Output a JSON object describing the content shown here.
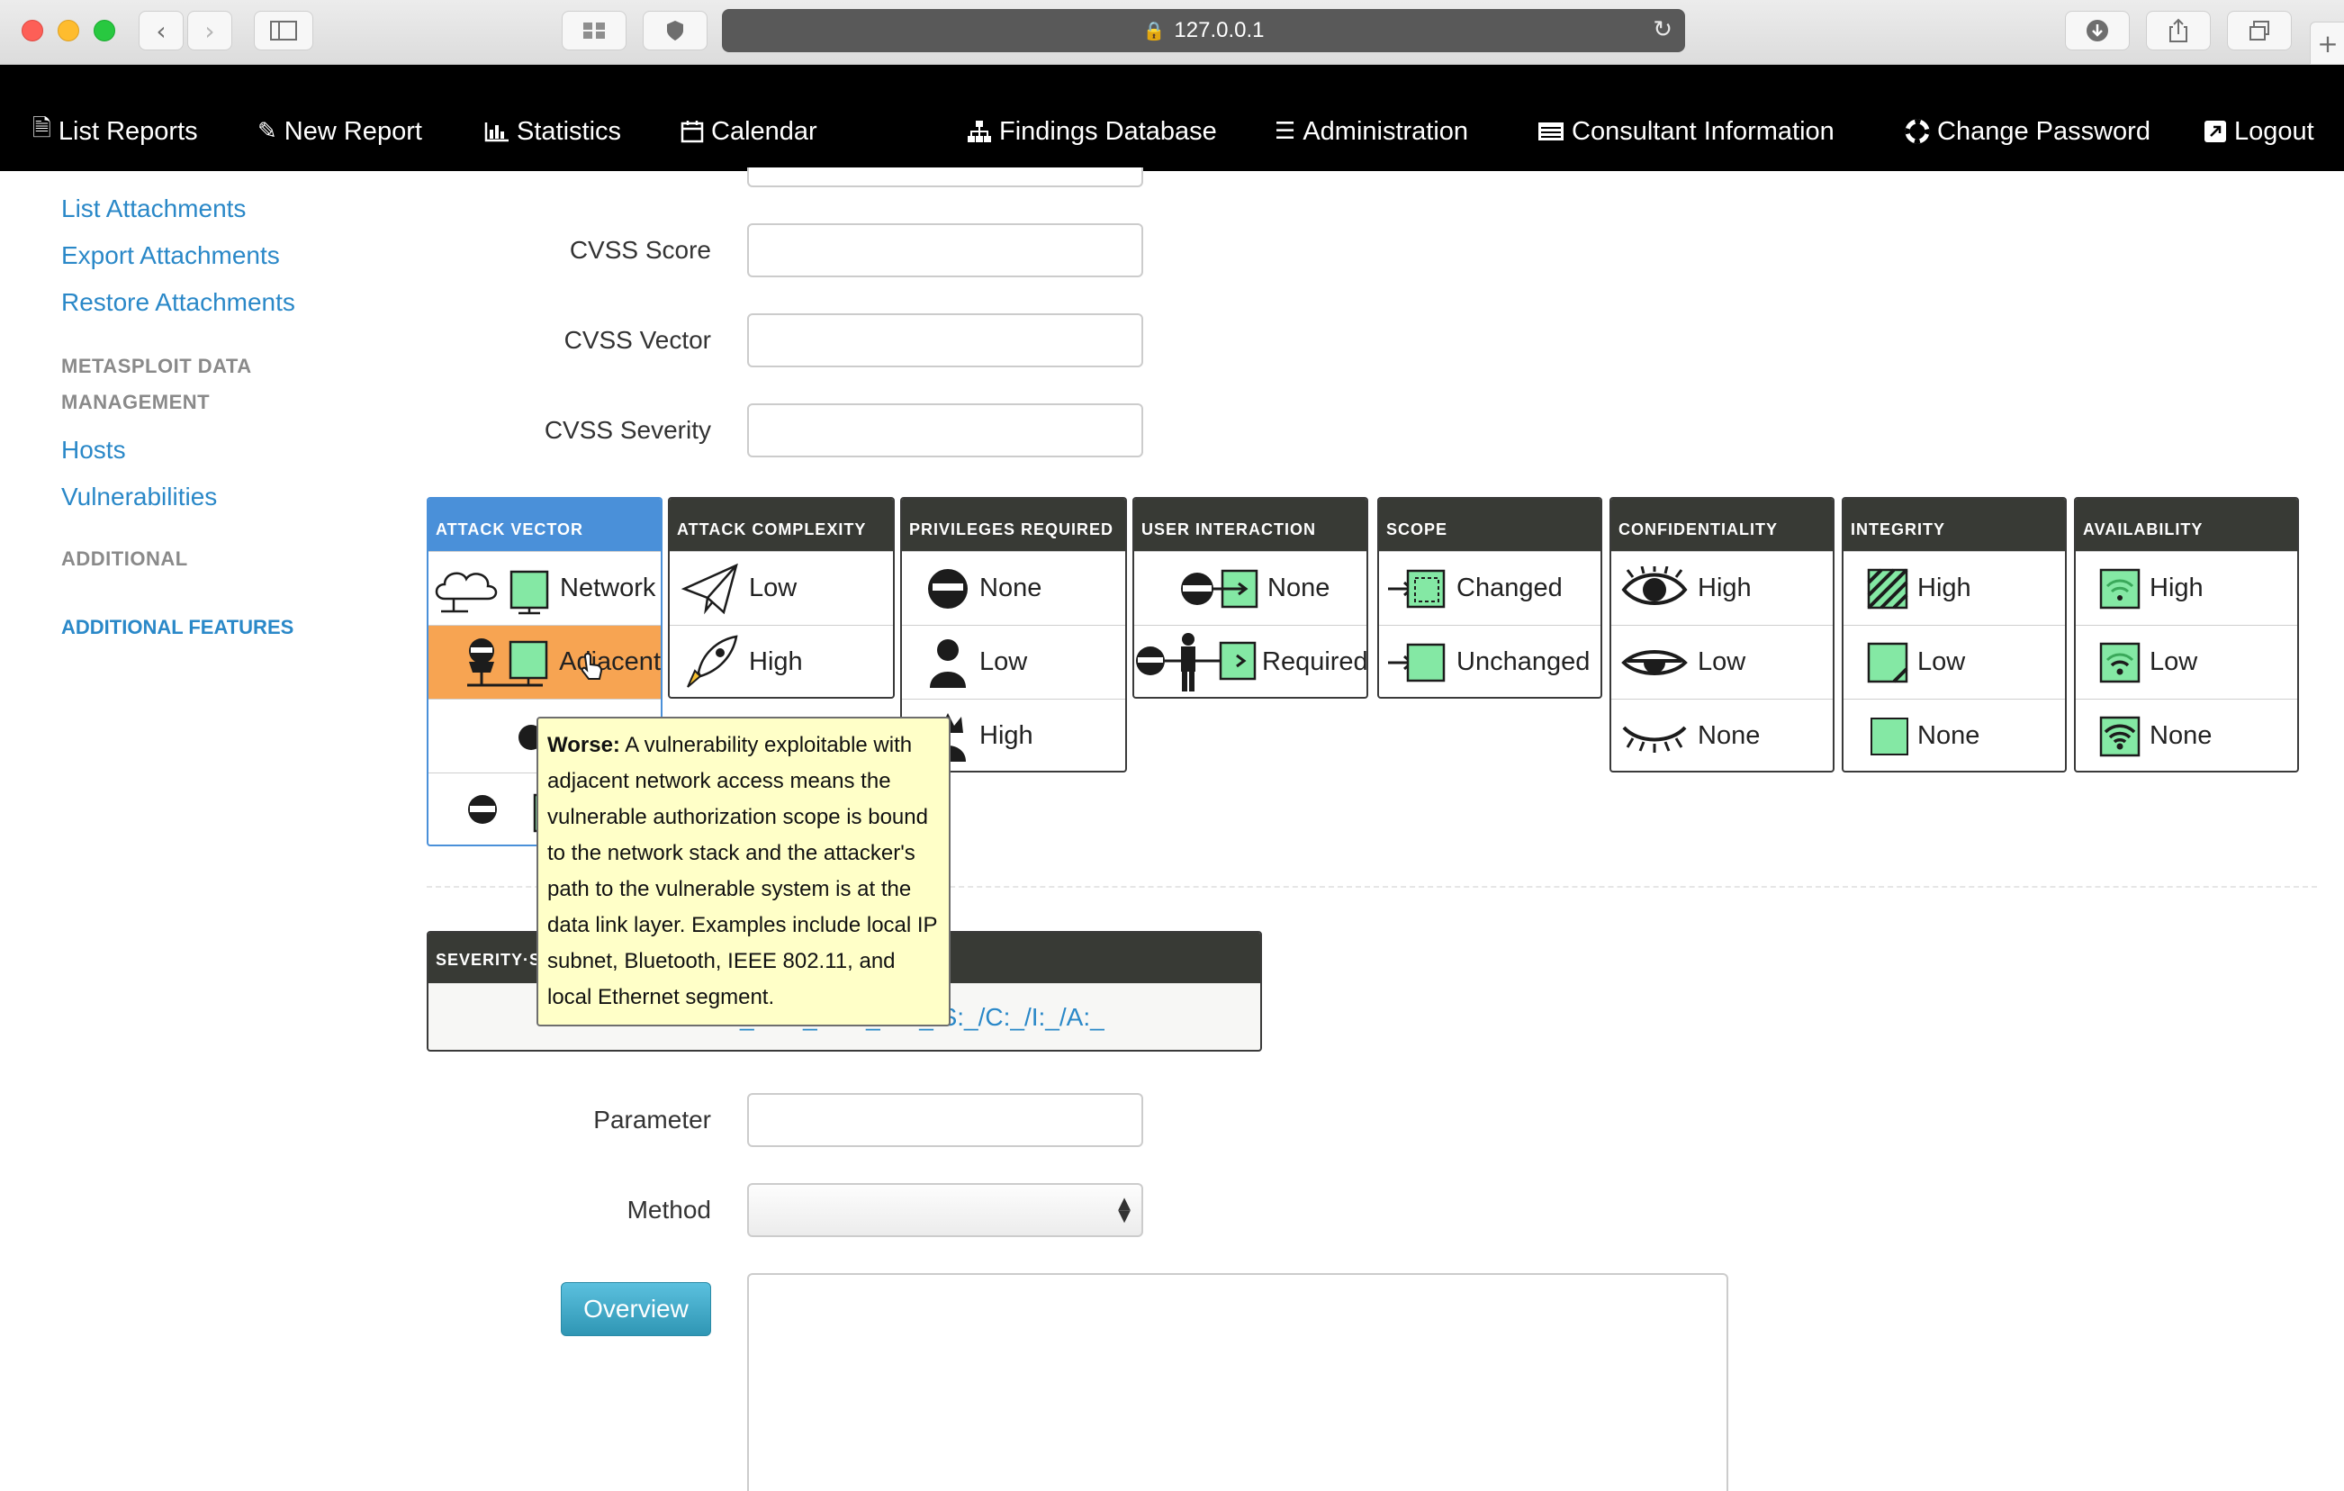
{
  "browser": {
    "url": "127.0.0.1",
    "new_tab": "+"
  },
  "nav": [
    {
      "label": "List Reports",
      "icon": "report-icon"
    },
    {
      "label": "New Report",
      "icon": "edit-icon"
    },
    {
      "label": "Statistics",
      "icon": "bar-chart-icon"
    },
    {
      "label": "Calendar",
      "icon": "calendar-icon"
    },
    {
      "label": "Findings Database",
      "icon": "sitemap-icon"
    },
    {
      "label": "Administration",
      "icon": "list-icon"
    },
    {
      "label": "Consultant Information",
      "icon": "id-card-icon"
    },
    {
      "label": "Change Password",
      "icon": "lifebuoy-icon"
    },
    {
      "label": "Logout",
      "icon": "external-link-icon"
    }
  ],
  "sidebar": {
    "links": [
      "List Attachments",
      "Export Attachments",
      "Restore Attachments"
    ],
    "metasploit_heading_line1": "METASPLOIT DATA",
    "metasploit_heading_line2": "MANAGEMENT",
    "metasploit_links": [
      "Hosts",
      "Vulnerabilities"
    ],
    "additional_heading": "ADDITIONAL",
    "additional_features": "ADDITIONAL FEATURES"
  },
  "form": {
    "cvss_score_label": "CVSS Score",
    "cvss_vector_label": "CVSS Vector",
    "cvss_severity_label": "CVSS Severity",
    "parameter_label": "Parameter",
    "method_label": "Method",
    "overview_button": "Overview"
  },
  "metrics": {
    "attack_vector": {
      "title": "ATTACK VECTOR",
      "options": [
        "Network",
        "Adjacent"
      ],
      "selected": "Adjacent"
    },
    "attack_complexity": {
      "title": "ATTACK COMPLEXITY",
      "options": [
        "Low",
        "High"
      ]
    },
    "privileges_required": {
      "title": "PRIVILEGES REQUIRED",
      "options": [
        "None",
        "Low",
        "High"
      ]
    },
    "user_interaction": {
      "title": "USER INTERACTION",
      "options": [
        "None",
        "Required"
      ]
    },
    "scope": {
      "title": "SCOPE",
      "options": [
        "Changed",
        "Unchanged"
      ]
    },
    "confidentiality": {
      "title": "CONFIDENTIALITY",
      "options": [
        "High",
        "Low",
        "None"
      ]
    },
    "integrity": {
      "title": "INTEGRITY",
      "options": [
        "High",
        "Low",
        "None"
      ]
    },
    "availability": {
      "title": "AVAILABILITY",
      "options": [
        "High",
        "Low",
        "None"
      ]
    }
  },
  "tooltip": {
    "bold": "Worse:",
    "text": "A vulnerability exploitable with adjacent network access means the vulnerable authorization scope is bound to the network stack and the attacker's path to the vulnerable system is at the data link layer. Examples include local IP subnet, Bluetooth, IEEE 802.11, and local Ethernet segment."
  },
  "severity": {
    "heading": "SEVERITY·S",
    "vector": "CVSS:3.0/AV:_/AC:_/PR:_/UI:_/S:_/C:_/I:_/A:_"
  },
  "colors": {
    "link": "#2a88c8",
    "selected": "#f7a452",
    "active_header": "#4a90d9",
    "metric_header": "#383a35",
    "tooltip_bg": "#ffffc8",
    "icon_green": "#84e8a4"
  }
}
